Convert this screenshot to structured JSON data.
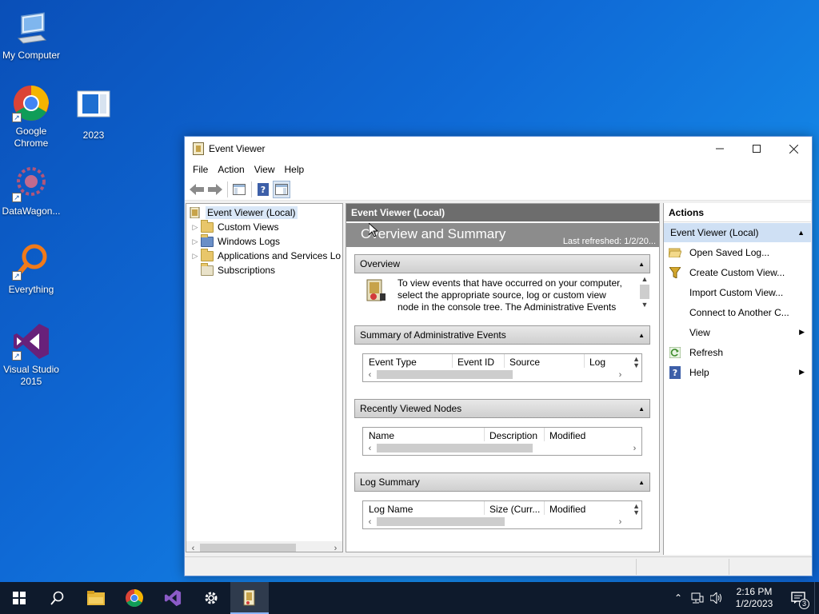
{
  "desktop": {
    "icons": [
      {
        "label": "My Computer"
      },
      {
        "label": "Google Chrome"
      },
      {
        "label": "2023"
      },
      {
        "label": "DataWagon..."
      },
      {
        "label": "Everything"
      },
      {
        "label": "Visual Studio 2015"
      }
    ]
  },
  "window": {
    "title": "Event Viewer",
    "menu": [
      "File",
      "Action",
      "View",
      "Help"
    ],
    "tree": {
      "root": "Event Viewer (Local)",
      "items": [
        "Custom Views",
        "Windows Logs",
        "Applications and Services Lo",
        "Subscriptions"
      ]
    },
    "middle": {
      "header": "Event Viewer (Local)",
      "banner_title": "Overview and Summary",
      "last_refreshed": "Last refreshed: 1/2/20...",
      "overview": {
        "title": "Overview",
        "text": "To view events that have occurred on your computer, select the appropriate source, log or custom view node in the console tree. The Administrative Events"
      },
      "summary": {
        "title": "Summary of Administrative Events",
        "columns": [
          "Event Type",
          "Event ID",
          "Source",
          "Log"
        ]
      },
      "recent": {
        "title": "Recently Viewed Nodes",
        "columns": [
          "Name",
          "Description",
          "Modified"
        ]
      },
      "log_summary": {
        "title": "Log Summary",
        "columns": [
          "Log Name",
          "Size (Curr...",
          "Modified"
        ]
      }
    },
    "actions": {
      "header": "Actions",
      "sub_header": "Event Viewer (Local)",
      "items": [
        {
          "label": "Open Saved Log...",
          "icon": "folder-open-icon"
        },
        {
          "label": "Create Custom View...",
          "icon": "filter-icon"
        },
        {
          "label": "Import Custom View...",
          "icon": ""
        },
        {
          "label": "Connect to Another C...",
          "icon": ""
        },
        {
          "label": "View",
          "icon": "",
          "submenu": true
        },
        {
          "label": "Refresh",
          "icon": "refresh-icon"
        },
        {
          "label": "Help",
          "icon": "help-icon",
          "submenu": true
        }
      ]
    }
  },
  "taskbar": {
    "time": "2:16 PM",
    "date": "1/2/2023",
    "notification_count": "3"
  }
}
